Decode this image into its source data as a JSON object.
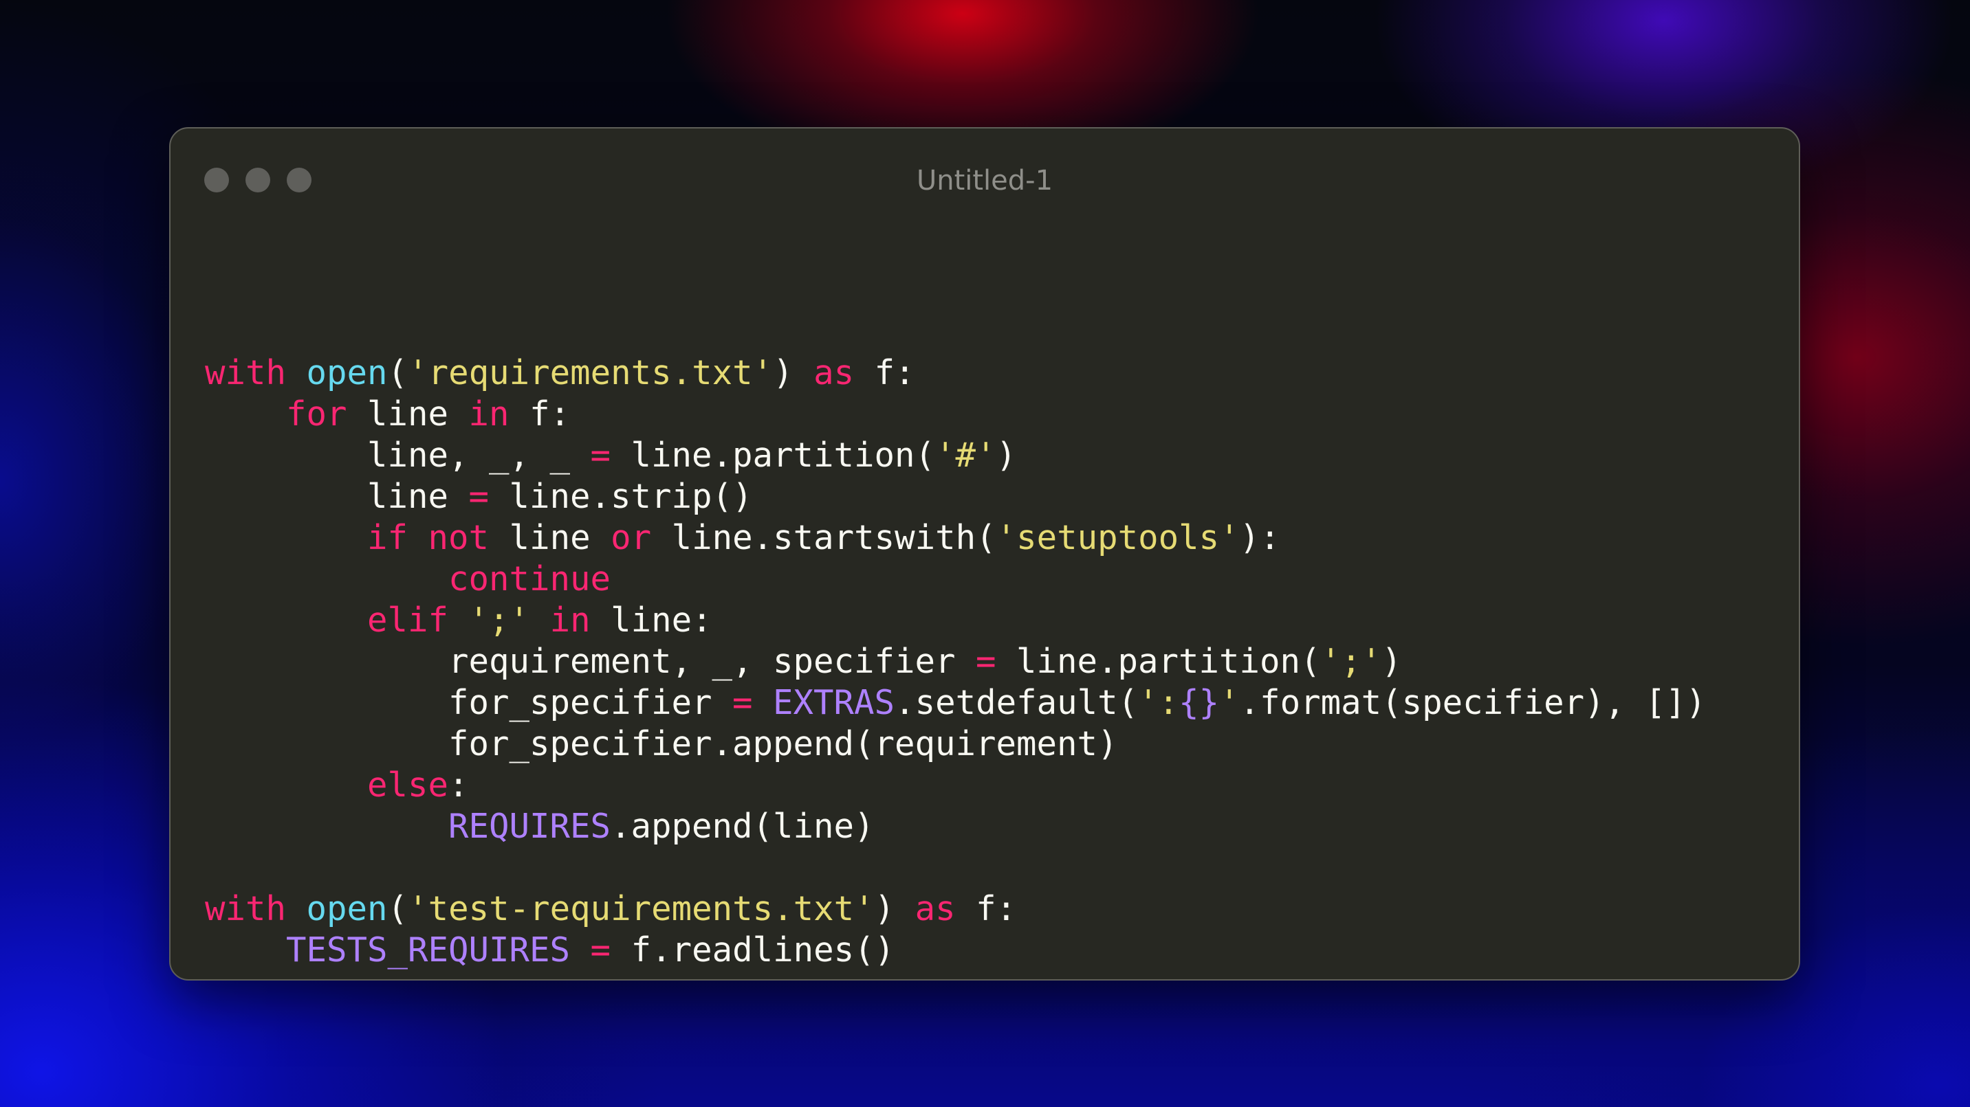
{
  "window": {
    "title": "Untitled-1"
  },
  "colors": {
    "editor_background": "#272822",
    "keyword": "#f92672",
    "builtin_function": "#66d9ef",
    "string": "#e6db74",
    "constant": "#ae81ff",
    "plain_text": "#f8f8f2"
  },
  "icons": [
    "close-dot-icon",
    "minimize-dot-icon",
    "maximize-dot-icon"
  ],
  "code_lines": [
    [
      [
        "kw",
        "with"
      ],
      [
        "pl",
        " "
      ],
      [
        "fn",
        "open"
      ],
      [
        "pl",
        "("
      ],
      [
        "str",
        "'requirements.txt'"
      ],
      [
        "pl",
        ") "
      ],
      [
        "kw",
        "as"
      ],
      [
        "pl",
        " f:"
      ]
    ],
    [
      [
        "pl",
        "    "
      ],
      [
        "kw",
        "for"
      ],
      [
        "pl",
        " line "
      ],
      [
        "kw",
        "in"
      ],
      [
        "pl",
        " f:"
      ]
    ],
    [
      [
        "pl",
        "        line, _, _ "
      ],
      [
        "op",
        "="
      ],
      [
        "pl",
        " line.partition("
      ],
      [
        "str",
        "'#'"
      ],
      [
        "pl",
        ")"
      ]
    ],
    [
      [
        "pl",
        "        line "
      ],
      [
        "op",
        "="
      ],
      [
        "pl",
        " line.strip()"
      ]
    ],
    [
      [
        "pl",
        "        "
      ],
      [
        "kw",
        "if"
      ],
      [
        "pl",
        " "
      ],
      [
        "kw",
        "not"
      ],
      [
        "pl",
        " line "
      ],
      [
        "kw",
        "or"
      ],
      [
        "pl",
        " line.startswith("
      ],
      [
        "str",
        "'setuptools'"
      ],
      [
        "pl",
        "):"
      ]
    ],
    [
      [
        "pl",
        "            "
      ],
      [
        "kw",
        "continue"
      ]
    ],
    [
      [
        "pl",
        "        "
      ],
      [
        "kw",
        "elif"
      ],
      [
        "pl",
        " "
      ],
      [
        "str",
        "';'"
      ],
      [
        "pl",
        " "
      ],
      [
        "kw",
        "in"
      ],
      [
        "pl",
        " line:"
      ]
    ],
    [
      [
        "pl",
        "            requirement, _, specifier "
      ],
      [
        "op",
        "="
      ],
      [
        "pl",
        " line.partition("
      ],
      [
        "str",
        "';'"
      ],
      [
        "pl",
        ")"
      ]
    ],
    [
      [
        "pl",
        "            for_specifier "
      ],
      [
        "op",
        "="
      ],
      [
        "pl",
        " "
      ],
      [
        "const",
        "EXTRAS"
      ],
      [
        "pl",
        ".setdefault("
      ],
      [
        "str",
        "':"
      ],
      [
        "const",
        "{}"
      ],
      [
        "str",
        "'"
      ],
      [
        "pl",
        ".format(specifier), [])"
      ]
    ],
    [
      [
        "pl",
        "            for_specifier.append(requirement)"
      ]
    ],
    [
      [
        "pl",
        "        "
      ],
      [
        "kw",
        "else"
      ],
      [
        "pl",
        ":"
      ]
    ],
    [
      [
        "pl",
        "            "
      ],
      [
        "const",
        "REQUIRES"
      ],
      [
        "pl",
        ".append(line)"
      ]
    ],
    [],
    [
      [
        "kw",
        "with"
      ],
      [
        "pl",
        " "
      ],
      [
        "fn",
        "open"
      ],
      [
        "pl",
        "("
      ],
      [
        "str",
        "'test-requirements.txt'"
      ],
      [
        "pl",
        ") "
      ],
      [
        "kw",
        "as"
      ],
      [
        "pl",
        " f:"
      ]
    ],
    [
      [
        "pl",
        "    "
      ],
      [
        "const",
        "TESTS_REQUIRES"
      ],
      [
        "pl",
        " "
      ],
      [
        "op",
        "="
      ],
      [
        "pl",
        " f.readlines()"
      ]
    ]
  ]
}
